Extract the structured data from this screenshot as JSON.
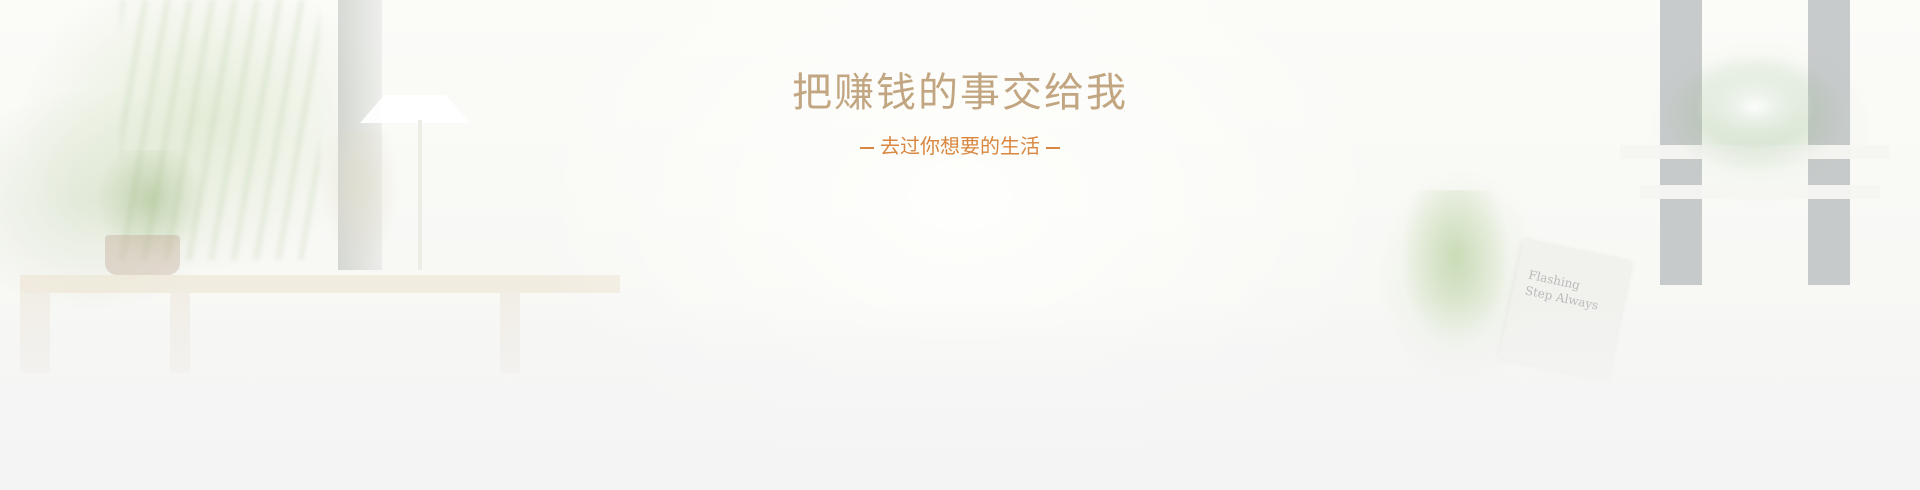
{
  "banner": {
    "headline": "把赚钱的事交给我",
    "subline": "去过你想要的生活",
    "book_text": "Flashing\nStep Always"
  },
  "colors": {
    "headline": "#c2a682",
    "subline": "#d9863e",
    "background": "#f6f6f4"
  }
}
